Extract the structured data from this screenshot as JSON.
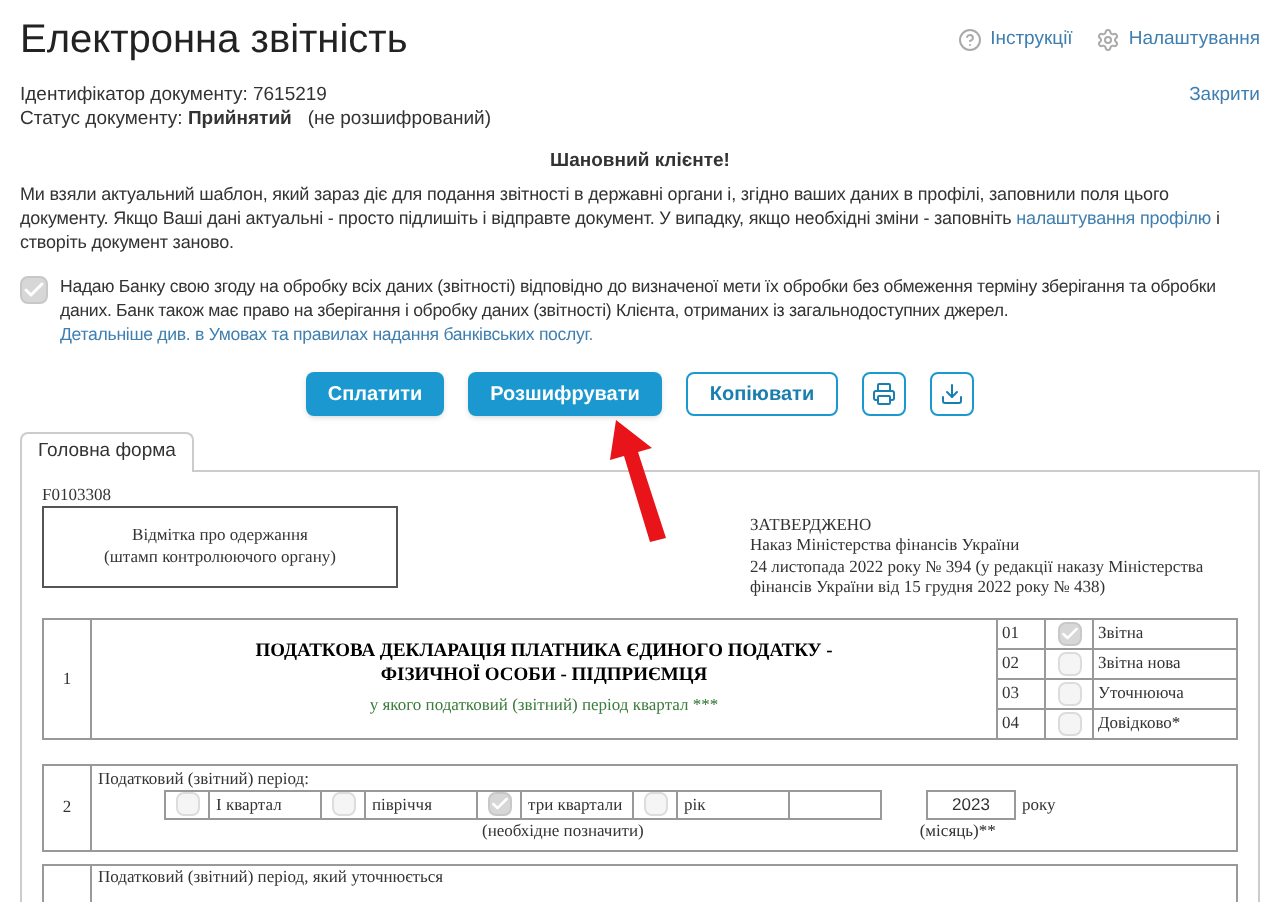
{
  "header": {
    "title": "Електронна звітність",
    "links": [
      {
        "kind": "help",
        "label": "Інструкції"
      },
      {
        "kind": "settings",
        "label": "Налаштування"
      }
    ]
  },
  "document": {
    "id_label": "Ідентифікатор документу:",
    "id_value": "7615219",
    "status_label": "Статус документу:",
    "status_value": "Прийнятий",
    "status_note": "(не розшифрований)",
    "close_link": "Закрити"
  },
  "notice": {
    "title": "Шановний клієнте!",
    "text": "Ми взяли актуальний шаблон, який зараз діє для подання звітності в державні органи і, згідно ваших даних в профілі, заповнили поля цього документу. Якщо Ваші дані актуальні - просто підлишіть і відправте документ. У випадку, якщо необхідні зміни - заповніть ",
    "link": "налаштування профілю",
    "text_after": " і створіть документ заново."
  },
  "consent": {
    "checked": true,
    "text": "Надаю Банку свою згоду на обробку всіх даних (звітності) відповідно до визначеної мети їх обробки без обмеження терміну зберігання та обробки даних. Банк також має право на зберігання і обробку даних (звітності) Клієнта, отриманих із загальнодоступних джерел. ",
    "link": "Детальніше див. в Умовах та правилах надання банківських послуг."
  },
  "actions": [
    {
      "kind": "primary",
      "label": "Сплатити"
    },
    {
      "kind": "primary",
      "label": "Розшифрувати"
    },
    {
      "kind": "outline",
      "label": "Копіювати"
    },
    {
      "kind": "print"
    },
    {
      "kind": "download"
    }
  ],
  "tabs": [
    {
      "label": "Головна форма",
      "selected": true
    }
  ],
  "form": {
    "code": "F0103308",
    "stamp_lines": [
      "Відмітка про одержання",
      "(штамп контролюючого органу)"
    ],
    "approval": [
      "ЗАТВЕРДЖЕНО",
      "Наказ Міністерства фінансів України",
      "24 листопада 2022 року № 394 (у редакції наказу Міністерства фінансів України від 15 грудня 2022 року № 438)"
    ],
    "row1": {
      "number": "1",
      "title": "ПОДАТКОВА ДЕКЛАРАЦІЯ ПЛАТНИКА ЄДИНОГО ПОДАТКУ - ФІЗИЧНОЇ ОСОБИ - ПІДПРИЄМЦЯ",
      "subtitle": "у якого податковий (звітний) період квартал ***",
      "types": [
        {
          "code": "01",
          "label": "Звітна",
          "checked": true
        },
        {
          "code": "02",
          "label": "Звітна нова",
          "checked": false
        },
        {
          "code": "03",
          "label": "Уточнююча",
          "checked": false
        },
        {
          "code": "04",
          "label": "Довідково*",
          "checked": false
        }
      ]
    },
    "row2": {
      "number": "2",
      "label": "Податковий (звітний) період:",
      "periods": [
        {
          "label": "I квартал",
          "checked": false
        },
        {
          "label": "півріччя",
          "checked": false
        },
        {
          "label": "три квартали",
          "checked": true
        },
        {
          "label": "рік",
          "checked": false
        }
      ],
      "note": "(необхідне позначити)",
      "month_note": "(місяць)**",
      "year": "2023",
      "year_suffix": "року"
    },
    "row3": {
      "label": "Податковий (звітний) період, який уточнюється"
    }
  }
}
